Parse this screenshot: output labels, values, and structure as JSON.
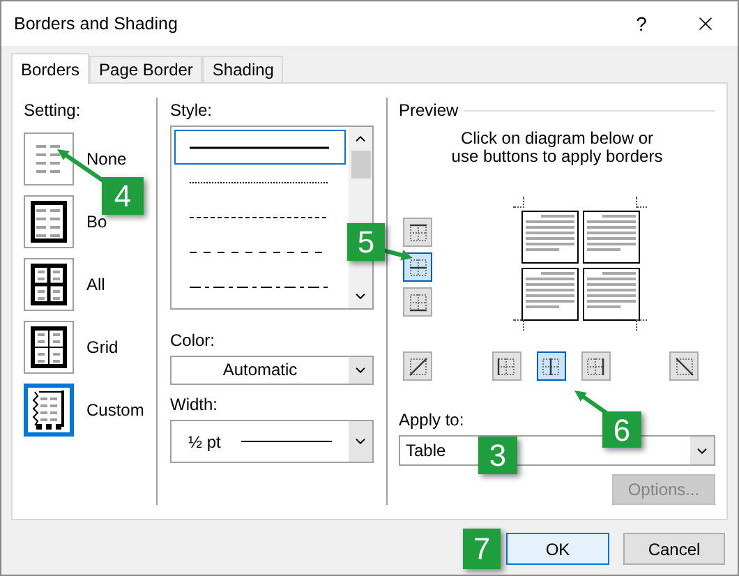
{
  "window": {
    "title": "Borders and Shading",
    "help": "?"
  },
  "tabs": [
    {
      "label": "Borders",
      "selected": true
    },
    {
      "label": "Page Border",
      "selected": false
    },
    {
      "label": "Shading",
      "selected": false
    }
  ],
  "setting": {
    "label": "Setting:",
    "options": [
      {
        "kind": "none",
        "label": "None",
        "selected": false
      },
      {
        "kind": "box",
        "label": "Bo",
        "selected": false
      },
      {
        "kind": "all",
        "label": "All",
        "selected": false
      },
      {
        "kind": "grid",
        "label": "Grid",
        "selected": false
      },
      {
        "kind": "custom",
        "label": "Custom",
        "selected": true
      }
    ]
  },
  "style": {
    "label": "Style:",
    "lines": [
      {
        "kind": "solid",
        "selected": true
      },
      {
        "kind": "dotted",
        "selected": false
      },
      {
        "kind": "dashed",
        "selected": false
      },
      {
        "kind": "long-dash",
        "selected": false
      },
      {
        "kind": "dash-dot",
        "selected": false
      }
    ]
  },
  "color": {
    "label": "Color:",
    "value": "Automatic"
  },
  "width": {
    "label": "Width:",
    "value": "½ pt"
  },
  "preview": {
    "title": "Preview",
    "instructions": [
      "Click on diagram below or",
      "use buttons to apply borders"
    ],
    "side_buttons": [
      {
        "kind": "top",
        "selected": false
      },
      {
        "kind": "inner-horizontal",
        "selected": true
      },
      {
        "kind": "bottom",
        "selected": false
      }
    ],
    "bottom_buttons": [
      {
        "kind": "diagonal-up",
        "selected": false
      },
      {
        "kind": "left",
        "selected": false
      },
      {
        "kind": "inner-vertical",
        "selected": true
      },
      {
        "kind": "right",
        "selected": false
      },
      {
        "kind": "diagonal-down",
        "selected": false
      }
    ]
  },
  "apply_to": {
    "label": "Apply to:",
    "value": "Table"
  },
  "options_button": {
    "label": "Options...",
    "disabled": true
  },
  "ok_button": {
    "label": "OK"
  },
  "cancel_button": {
    "label": "Cancel"
  },
  "callouts": [
    {
      "label": "4"
    },
    {
      "label": "5"
    },
    {
      "label": "6"
    },
    {
      "label": "3"
    },
    {
      "label": "7"
    }
  ]
}
